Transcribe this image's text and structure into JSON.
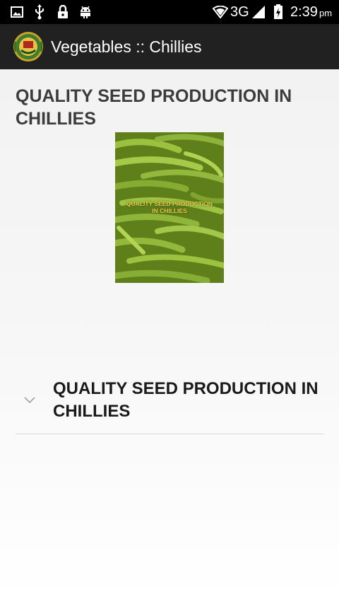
{
  "status_bar": {
    "network": "3G",
    "time": "2:39",
    "ampm": "pm",
    "icons": [
      "image-icon",
      "usb-icon",
      "lock-icon",
      "android-debug-icon",
      "wifi-hotspot-icon",
      "signal-icon",
      "battery-charging-icon"
    ]
  },
  "app_bar": {
    "title": "Vegetables :: Chillies",
    "logo_icon": "university-emblem-icon"
  },
  "main": {
    "heading": "QUALITY SEED PRODUCTION IN CHILLIES",
    "cover_image": {
      "caption_line1": "QUALITY SEED PRODUCTION",
      "caption_line2": "IN CHILLIES"
    },
    "accordion": [
      {
        "title": "QUALITY SEED PRODUCTION IN CHILLIES",
        "icon": "chevron-down-icon",
        "expanded": false
      }
    ]
  },
  "colors": {
    "status_bar_bg": "#000000",
    "app_bar_bg": "#212121",
    "heading_text": "#3c3c3c",
    "chilli_green": "#8db33a",
    "caption_yellow": "#e8d334"
  }
}
